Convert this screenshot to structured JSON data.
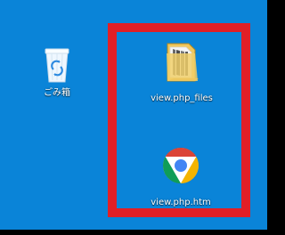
{
  "desktop": {
    "background_color": "#0a84d8",
    "highlight_color": "#e11f26",
    "icons": [
      {
        "label": "ごみ箱",
        "icon": "recycle-bin-icon"
      },
      {
        "label": "view.php_files",
        "icon": "folder-icon"
      },
      {
        "label": "view.php.htm",
        "icon": "chrome-icon"
      }
    ]
  }
}
